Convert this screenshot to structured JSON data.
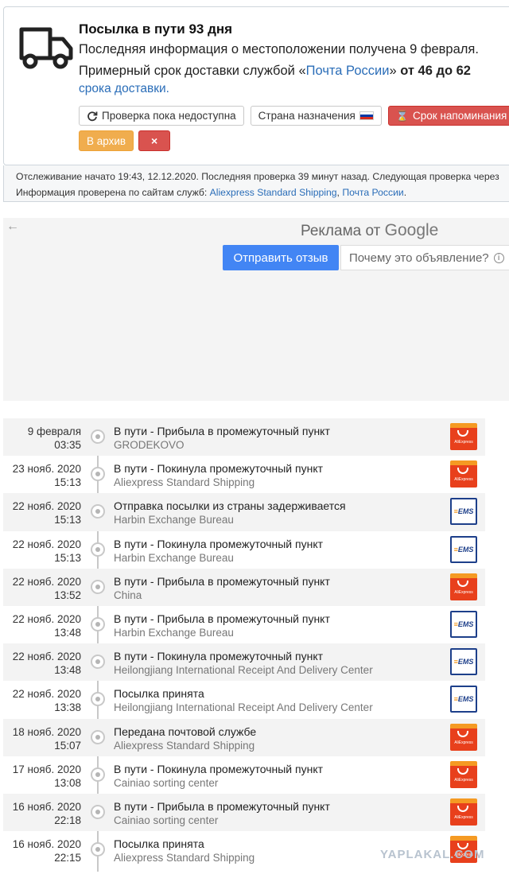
{
  "header": {
    "title": "Посылка в пути 93 дня",
    "line1": "Последняя информация о местоположении получена 9 февраля.",
    "line2_prefix": "Примерный срок доставки службой «",
    "line2_service": "Почта России",
    "line2_mid": "» ",
    "line2_range": "от 46 до 62",
    "line3": "срока доставки.",
    "buttons": {
      "check": "Проверка пока недоступна",
      "country": "Страна назначения",
      "reminder": "Срок напоминания",
      "archive": "В архив",
      "delete": "×"
    }
  },
  "info": {
    "line1": "Отслеживание начато 19:43, 12.12.2020. Последняя проверка 39 минут назад. Следующая проверка через",
    "line2_prefix": "Информация проверена по сайтам служб: ",
    "service1": "Aliexpress Standard Shipping",
    "sep": ", ",
    "service2": "Почта России",
    "end": "."
  },
  "ad": {
    "back": "←",
    "label_prefix": "Реклама от ",
    "label_brand": "Google",
    "send": "Отправить отзыв",
    "why": "Почему это объявление?",
    "info_icon": "i"
  },
  "events": [
    {
      "date": "9 февраля",
      "time": "03:35",
      "title": "В пути - Прибыла в промежуточный пункт",
      "place": "GRODEKOVO",
      "logo": "ali"
    },
    {
      "date": "23 нояб. 2020",
      "time": "15:13",
      "title": "В пути - Покинула промежуточный пункт",
      "place": "Aliexpress Standard Shipping",
      "logo": "ali"
    },
    {
      "date": "22 нояб. 2020",
      "time": "15:13",
      "title": "Отправка посылки из страны задерживается",
      "place": "Harbin Exchange Bureau",
      "logo": "ems"
    },
    {
      "date": "22 нояб. 2020",
      "time": "15:13",
      "title": "В пути - Покинула промежуточный пункт",
      "place": "Harbin Exchange Bureau",
      "logo": "ems"
    },
    {
      "date": "22 нояб. 2020",
      "time": "13:52",
      "title": "В пути - Прибыла в промежуточный пункт",
      "place": "China",
      "logo": "ali"
    },
    {
      "date": "22 нояб. 2020",
      "time": "13:48",
      "title": "В пути - Прибыла в промежуточный пункт",
      "place": "Harbin Exchange Bureau",
      "logo": "ems"
    },
    {
      "date": "22 нояб. 2020",
      "time": "13:48",
      "title": "В пути - Покинула промежуточный пункт",
      "place": "Heilongjiang International Receipt And Delivery Center",
      "logo": "ems"
    },
    {
      "date": "22 нояб. 2020",
      "time": "13:38",
      "title": "Посылка принята",
      "place": "Heilongjiang International Receipt And Delivery Center",
      "logo": "ems"
    },
    {
      "date": "18 нояб. 2020",
      "time": "15:07",
      "title": "Передана почтовой службе",
      "place": "Aliexpress Standard Shipping",
      "logo": "ali"
    },
    {
      "date": "17 нояб. 2020",
      "time": "13:08",
      "title": "В пути - Покинула промежуточный пункт",
      "place": "Cainiao sorting center",
      "logo": "ali"
    },
    {
      "date": "16 нояб. 2020",
      "time": "22:18",
      "title": "В пути - Прибыла в промежуточный пункт",
      "place": "Cainiao sorting center",
      "logo": "ali"
    },
    {
      "date": "16 нояб. 2020",
      "time": "22:15",
      "title": "Посылка принята",
      "place": "Aliexpress Standard Shipping",
      "logo": "ali"
    }
  ],
  "logos": {
    "ali_text": "AliExpress",
    "ems_e": "EMS"
  },
  "watermark": "YAPLAKAL.COM"
}
